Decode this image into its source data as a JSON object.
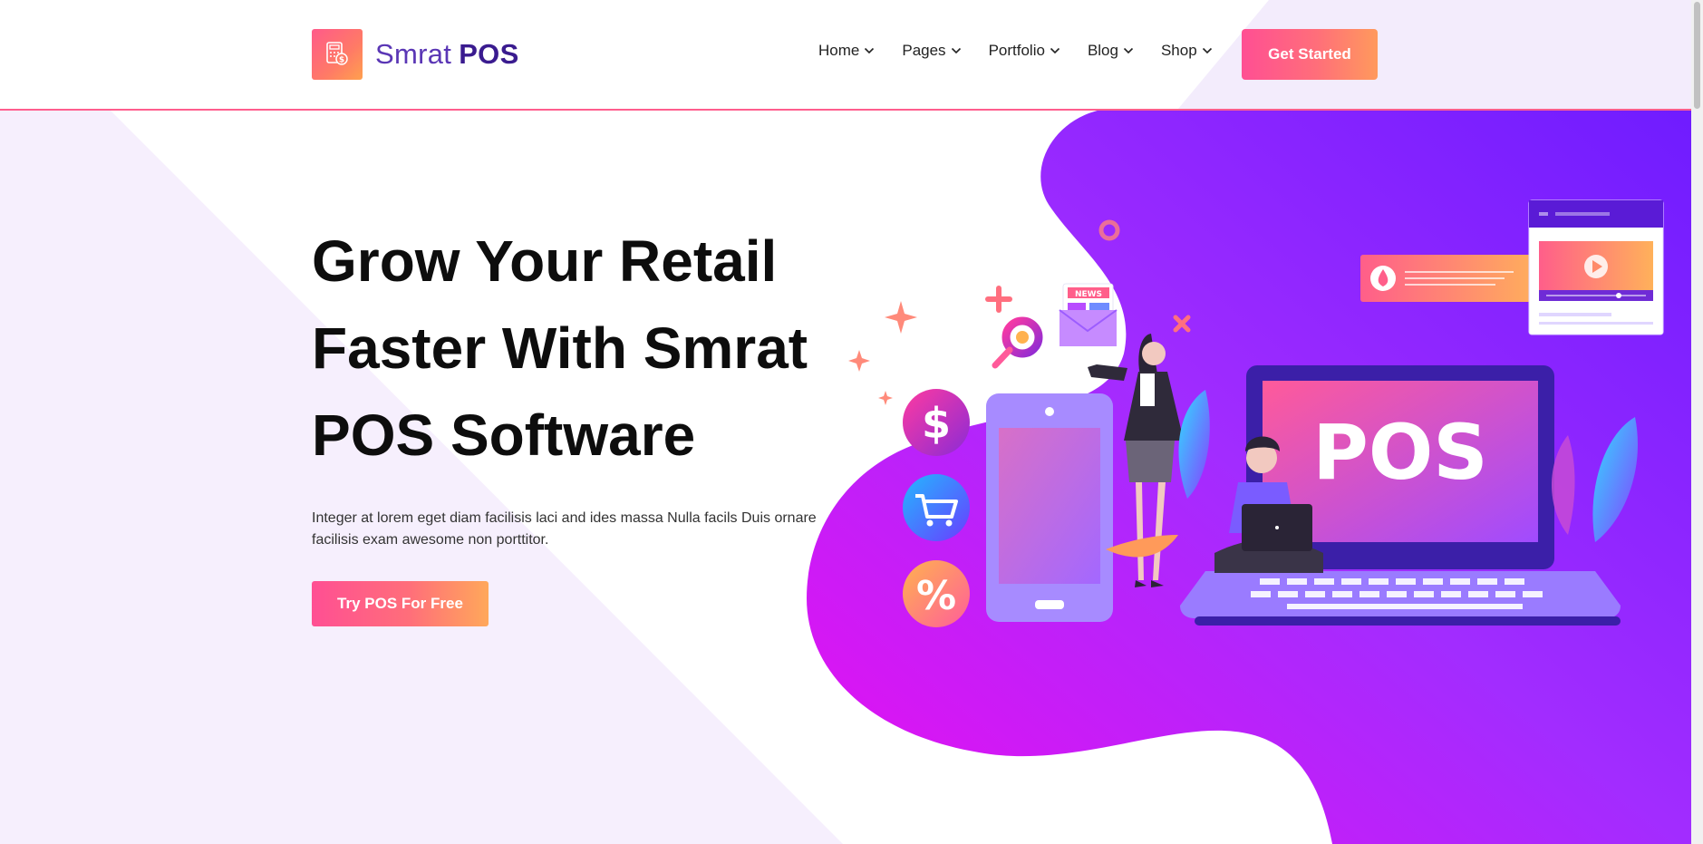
{
  "brand": {
    "name_light": "Smrat",
    "name_bold": "POS",
    "logo_icon": "calculator-dollar-icon"
  },
  "nav": {
    "items": [
      {
        "label": "Home"
      },
      {
        "label": "Pages"
      },
      {
        "label": "Portfolio"
      },
      {
        "label": "Blog"
      },
      {
        "label": "Shop"
      }
    ],
    "cta_label": "Get Started"
  },
  "hero": {
    "title_line1": "Grow Your Retail",
    "title_line2": "Faster With Smrat",
    "title_line3": "POS Software",
    "description": "Integer at lorem eget diam facilisis laci and ides massa Nulla facils Duis ornare facilisis exam awesome non porttitor.",
    "button_label": "Try POS For Free"
  },
  "illustration": {
    "laptop_screen_text": "POS",
    "news_badge": "NEWS",
    "icons": [
      "dollar-icon",
      "cart-icon",
      "percent-icon",
      "envelope-news-icon",
      "magnifier-chart-icon",
      "play-video-icon"
    ]
  },
  "colors": {
    "accent_pink": "#ff4f93",
    "accent_orange": "#ffa85a",
    "purple": "#7b22ff",
    "magenta": "#e01cf0",
    "header_border": "#ff5e8e"
  }
}
